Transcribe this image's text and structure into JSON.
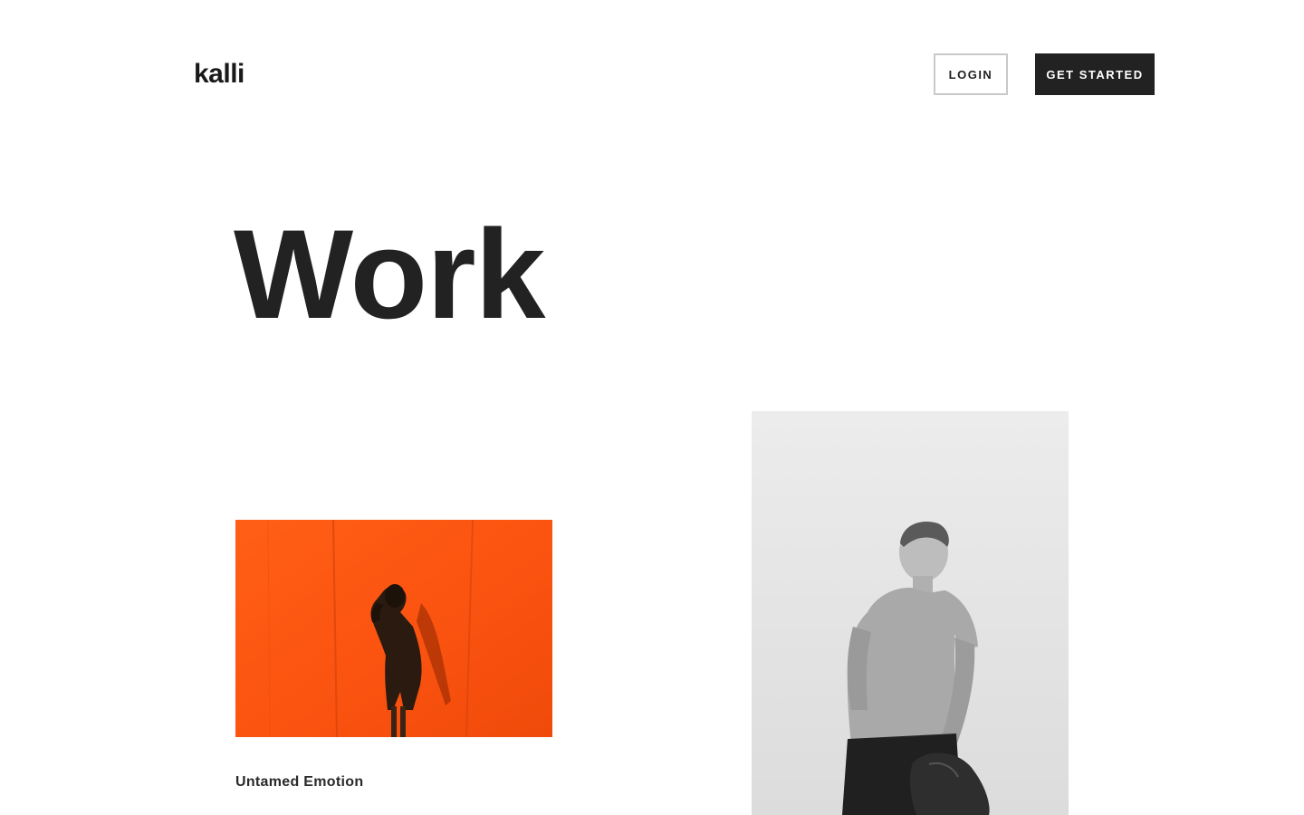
{
  "header": {
    "logo_text": "kalli",
    "login_label": "LOGIN",
    "get_started_label": "GET STARTED"
  },
  "hero": {
    "title": "Work"
  },
  "work_items": [
    {
      "caption": "Untamed Emotion",
      "image": "woman-against-orange-wall-photo"
    },
    {
      "caption": "",
      "image": "young-man-black-and-white-photo"
    }
  ],
  "colors": {
    "text": "#222222",
    "button_dark": "#222222",
    "button_border": "#c9c9c9",
    "orange_wall": "#ff5a14",
    "background": "#ffffff"
  }
}
